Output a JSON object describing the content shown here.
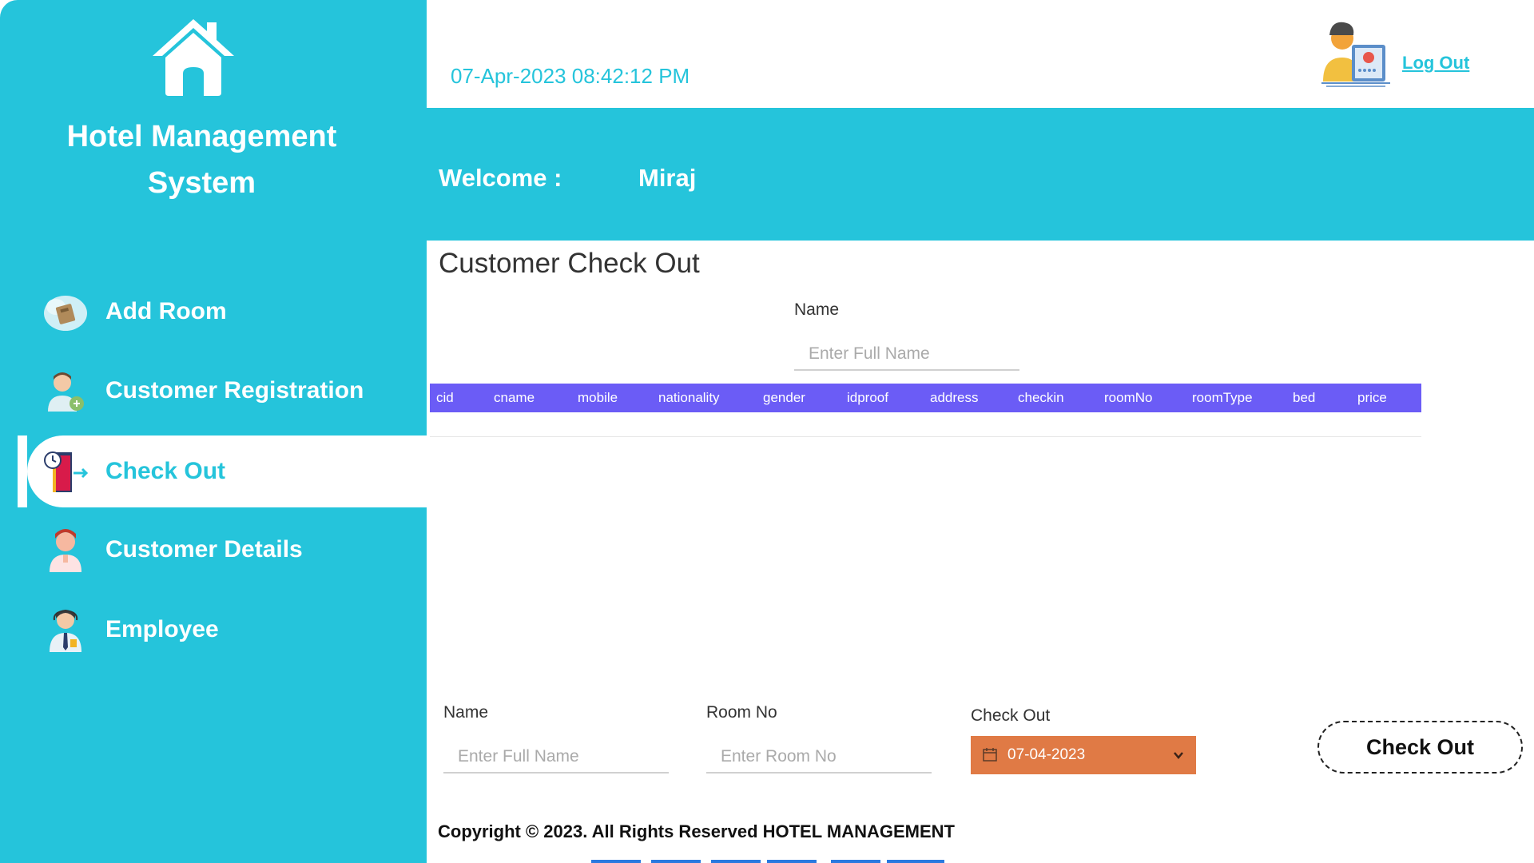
{
  "sidebar": {
    "title_line1": "Hotel Management",
    "title_line2": "System",
    "items": [
      {
        "label": "Add Room",
        "icon": "add-room-icon"
      },
      {
        "label": "Customer Registration",
        "icon": "customer-registration-icon"
      },
      {
        "label": "Check Out",
        "icon": "checkout-door-icon",
        "active": true
      },
      {
        "label": "Customer Details",
        "icon": "customer-details-icon"
      },
      {
        "label": "Employee",
        "icon": "employee-icon"
      }
    ]
  },
  "header": {
    "datetime": "07-Apr-2023 08:42:12 PM",
    "logout_label": "Log Out",
    "welcome_label": "Welcome :",
    "user_name": "Miraj"
  },
  "main": {
    "title": "Customer Check Out",
    "search": {
      "label": "Name",
      "placeholder": "Enter Full Name",
      "value": ""
    },
    "table": {
      "columns": [
        "cid",
        "cname",
        "mobile",
        "nationality",
        "gender",
        "idproof",
        "address",
        "checkin",
        "roomNo",
        "roomType",
        "bed",
        "price"
      ],
      "rows": []
    },
    "form": {
      "name": {
        "label": "Name",
        "placeholder": "Enter Full Name",
        "value": ""
      },
      "room_no": {
        "label": "Room No",
        "placeholder": "Enter Room No",
        "value": ""
      },
      "check_out": {
        "label": "Check Out",
        "value": "07-04-2023"
      },
      "submit_label": "Check Out"
    }
  },
  "footer": {
    "copyright": "Copyright © 2023. All Rights Reserved HOTEL MANAGEMENT"
  },
  "colors": {
    "primary": "#25c4db",
    "table_header": "#6b5cf6",
    "date_picker": "#e07a45"
  }
}
